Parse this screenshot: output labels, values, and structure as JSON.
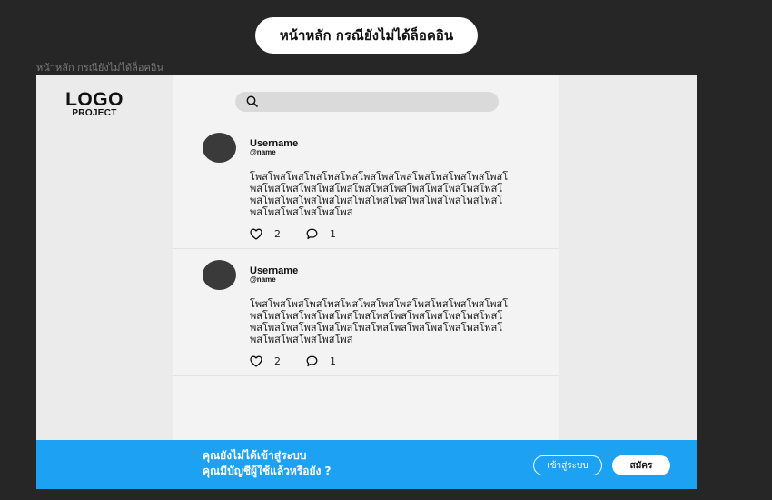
{
  "header": {
    "title": "หน้าหลัก กรณียังไม่ได้ล็อคอิน",
    "frame_label": "หน้าหลัก กรณียังไม่ได้ล็อคอิน"
  },
  "logo": {
    "main": "LOGO",
    "sub": "PROJECT"
  },
  "search": {
    "placeholder": "",
    "icon": "search-icon"
  },
  "posts": [
    {
      "username": "Username",
      "handle": "@name",
      "text": "โพสโพสโพสโพสโพสโพสโพสโพสโพสโพสโพสโพสโพสโพสโพสโพสโพสโพสโพสโพสโพสโพสโพสโพสโพสโพสโพสโพสโพสโพสโพสโพสโพสโพสโพสโพสโพสโพสโพสโพสโพสโพสโพสโพสโพสโพสโพสโพส",
      "likes": "2",
      "comments": "1"
    },
    {
      "username": "Username",
      "handle": "@name",
      "text": "โพสโพสโพสโพสโพสโพสโพสโพสโพสโพสโพสโพสโพสโพสโพสโพสโพสโพสโพสโพสโพสโพสโพสโพสโพสโพสโพสโพสโพสโพสโพสโพสโพสโพสโพสโพสโพสโพสโพสโพสโพสโพสโพสโพสโพสโพสโพสโพส",
      "likes": "2",
      "comments": "1"
    }
  ],
  "banner": {
    "line1": "คุณยังไม่ได้เข้าสู่ระบบ",
    "line2": "คุณมีบัญชีผู้ใช้แล้วหรือยัง ?",
    "login_label": "เข้าสู่ระบบ",
    "signup_label": "สมัคร",
    "color": "#1da1f2"
  },
  "icons": {
    "like": "heart-icon",
    "comment": "comment-icon"
  }
}
